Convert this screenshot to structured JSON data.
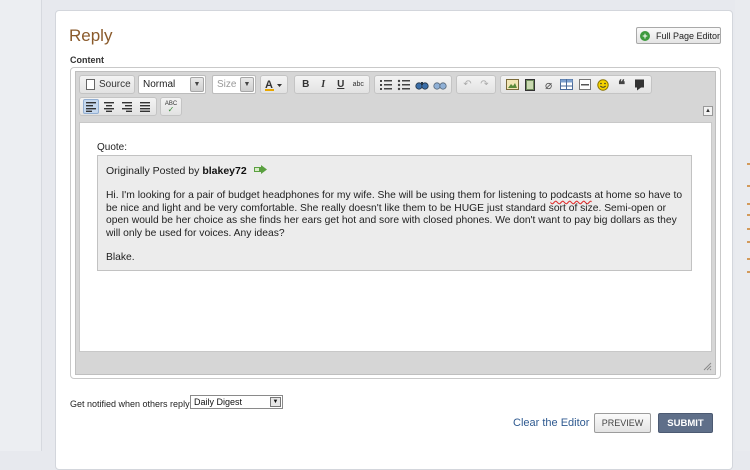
{
  "reply": {
    "title": "Reply",
    "full_page_editor_label": "Full Page Editor",
    "content_label": "Content"
  },
  "toolbar": {
    "source_label": "Source",
    "format_value": "Normal",
    "size_placeholder": "Size",
    "icons": [
      "text-color-icon",
      "bold-icon",
      "italic-icon",
      "underline-icon",
      "strikethrough-icon",
      "numbered-list-icon",
      "bulleted-list-icon",
      "find-icon",
      "replace-icon",
      "undo-icon",
      "redo-icon",
      "image-icon",
      "video-icon",
      "attachment-icon",
      "table-icon",
      "horizontal-rule-icon",
      "smiley-icon",
      "quote-icon",
      "comment-icon",
      "align-left-icon",
      "align-center-icon",
      "align-right-icon",
      "justify-icon",
      "spellcheck-icon"
    ],
    "bold": "B",
    "italic": "I",
    "underline": "U",
    "strike": "abc",
    "spell": "ABC"
  },
  "editor": {
    "quote_label": "Quote:",
    "originally_posted_by": "Originally Posted by",
    "author": "blakey72",
    "text_before": "Hi. I'm looking for a pair of budget headphones for my wife. She will be using them for listening to ",
    "text_misspelled": "podcasts",
    "text_after": " at home so have to be nice and light and be very comfortable. She really doesn't like them to be HUGE just standard sort of size. Semi-open or open would be her choice as she finds her ears get hot and sore with closed phones. We don't want to pay big dollars as they will only be used for voices. Any ideas?",
    "signature": "Blake."
  },
  "footer": {
    "notify_label": "Get notified when others reply?",
    "notify_value": "Daily Digest",
    "clear_label": "Clear the Editor",
    "preview_label": "PREVIEW",
    "submit_label": "SUBMIT"
  },
  "colors": {
    "title": "#8a5a2b",
    "submit_bg": "#5f6f89",
    "link": "#2f5a90",
    "spell_error": "#e03030"
  }
}
